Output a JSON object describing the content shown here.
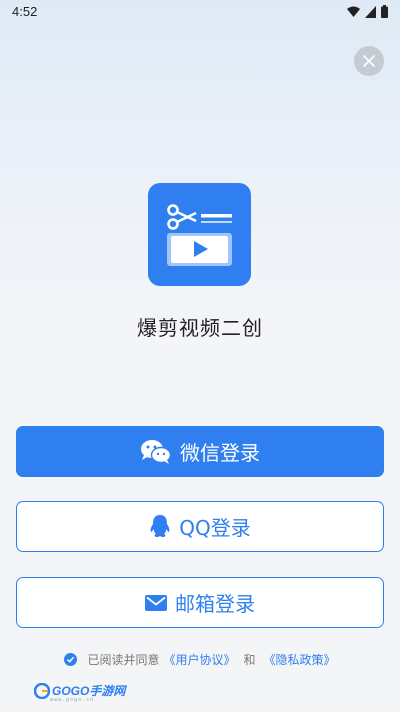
{
  "status_bar": {
    "time": "4:52"
  },
  "app": {
    "name": "爆剪视频二创"
  },
  "login": {
    "wechat_label": "微信登录",
    "qq_label": "QQ登录",
    "email_label": "邮箱登录"
  },
  "agreement": {
    "prefix": "已阅读并同意",
    "user_agreement": "《用户协议》",
    "and": "和",
    "privacy_policy": "《隐私政策》",
    "checked": true
  },
  "watermark": {
    "logo_text": "GOGO手游网",
    "sub_text": "www.gogo.cn"
  },
  "colors": {
    "accent": "#2f7ff0",
    "background": "#f4f5f7",
    "close_bg": "#c5cbd3"
  },
  "icons": [
    "wifi-icon",
    "signal-icon",
    "battery-icon",
    "close-icon",
    "scissors-icon",
    "play-icon",
    "wechat-icon",
    "qq-icon",
    "mail-icon",
    "check-icon"
  ]
}
